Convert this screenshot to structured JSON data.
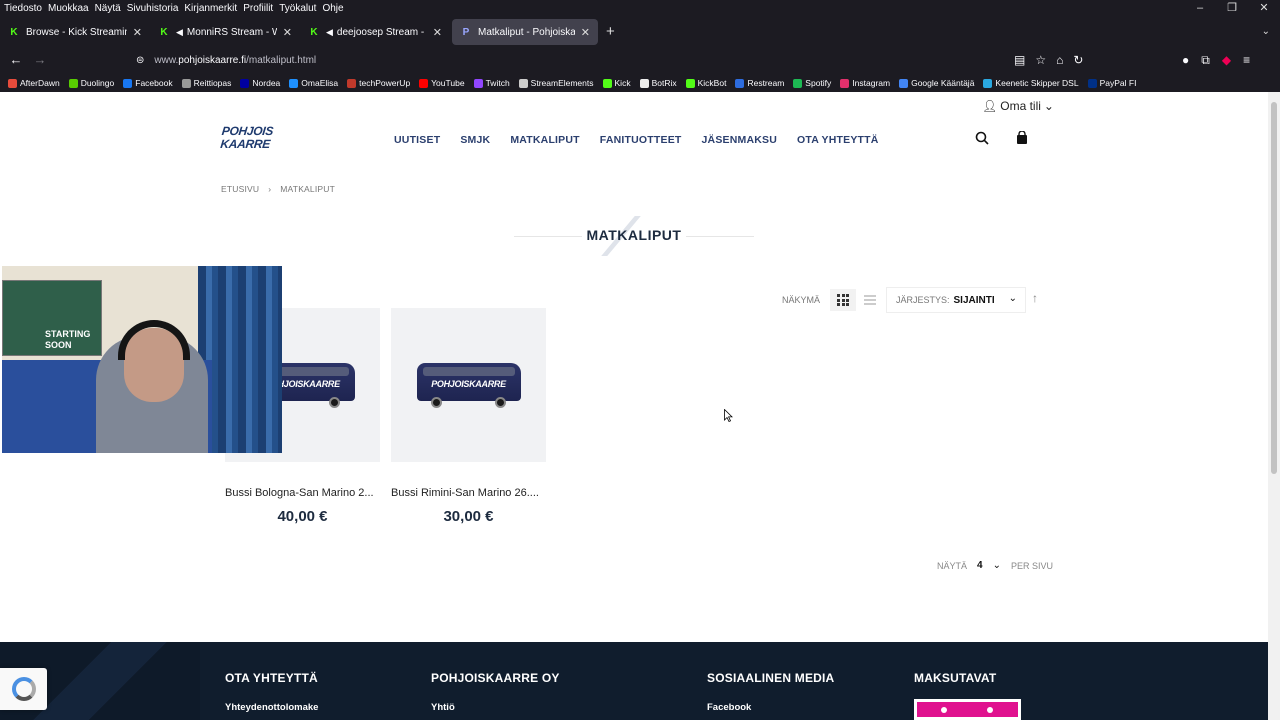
{
  "browser": {
    "menu": [
      "Tiedosto",
      "Muokkaa",
      "Näytä",
      "Sivuhistoria",
      "Kirjanmerkit",
      "Profiilit",
      "Työkalut",
      "Ohje"
    ],
    "tabs": [
      {
        "title": "Browse - Kick Streaming",
        "favicon": "K"
      },
      {
        "title": "MonniRS Stream - Watch Li",
        "favicon": "K"
      },
      {
        "title": "deejoosep Stream - Watch",
        "favicon": "K"
      },
      {
        "title": "Matkaliput - Pohjoiskaarre Oy",
        "favicon": "P"
      }
    ],
    "url_prefix": "www.",
    "url_domain": "pohjoiskaarre.fi",
    "url_path": "/matkaliput.html",
    "bookmarks": [
      {
        "label": "AfterDawn",
        "color": "#e74c3c"
      },
      {
        "label": "Duolingo",
        "color": "#58cc02"
      },
      {
        "label": "Facebook",
        "color": "#1877f2"
      },
      {
        "label": "Reittiopas",
        "color": "#999999"
      },
      {
        "label": "Nordea",
        "color": "#0000a0"
      },
      {
        "label": "OmaElisa",
        "color": "#1e90ff"
      },
      {
        "label": "techPowerUp",
        "color": "#c0392b"
      },
      {
        "label": "YouTube",
        "color": "#ff0000"
      },
      {
        "label": "Twitch",
        "color": "#9146ff"
      },
      {
        "label": "StreamElements",
        "color": "#cccccc"
      },
      {
        "label": "Kick",
        "color": "#53fc18"
      },
      {
        "label": "BotRix",
        "color": "#eeeeee"
      },
      {
        "label": "KickBot",
        "color": "#53fc18"
      },
      {
        "label": "Restream",
        "color": "#2d6cdf"
      },
      {
        "label": "Spotify",
        "color": "#1db954"
      },
      {
        "label": "Instagram",
        "color": "#e1306c"
      },
      {
        "label": "Google Kääntäjä",
        "color": "#4285f4"
      },
      {
        "label": "Keenetic Skipper DSL",
        "color": "#2aa8e0"
      },
      {
        "label": "PayPal FI",
        "color": "#003087"
      }
    ]
  },
  "site": {
    "account_label": "Oma tili",
    "logo_line1": "POHJOIS",
    "logo_line2": "KAARRE",
    "nav": [
      "UUTISET",
      "SMJK",
      "MATKALIPUT",
      "FANITUOTTEET",
      "JÄSENMAKSU",
      "OTA YHTEYTTÄ"
    ],
    "breadcrumb": [
      "ETUSIVU",
      "MATKALIPUT"
    ],
    "page_title": "MATKALIPUT",
    "view_label": "NÄKYMÄ",
    "sort_label": "JÄRJESTYS:",
    "sort_value": "SIJAINTI",
    "products": [
      {
        "name": "Bussi Bologna-San Marino 2...",
        "price": "40,00 €",
        "bus_text": "POHJOISKAARRE"
      },
      {
        "name": "Bussi Rimini-San Marino 26....",
        "price": "30,00 €",
        "bus_text": "POHJOISKAARRE"
      }
    ],
    "perpage_label": "NÄYTÄ",
    "perpage_value": "4",
    "perpage_suffix": "PER SIVU",
    "footer": {
      "col1_title": "OTA YHTEYTTÄ",
      "col1_link": "Yhteydenottolomake",
      "col2_title": "POHJOISKAARRE OY",
      "col2_link": "Yhtiö",
      "col3_title": "SOSIAALINEN MEDIA",
      "col3_link": "Facebook",
      "col4_title": "MAKSUTAVAT"
    }
  },
  "webcam": {
    "poster_text": "STARTING SOON"
  }
}
